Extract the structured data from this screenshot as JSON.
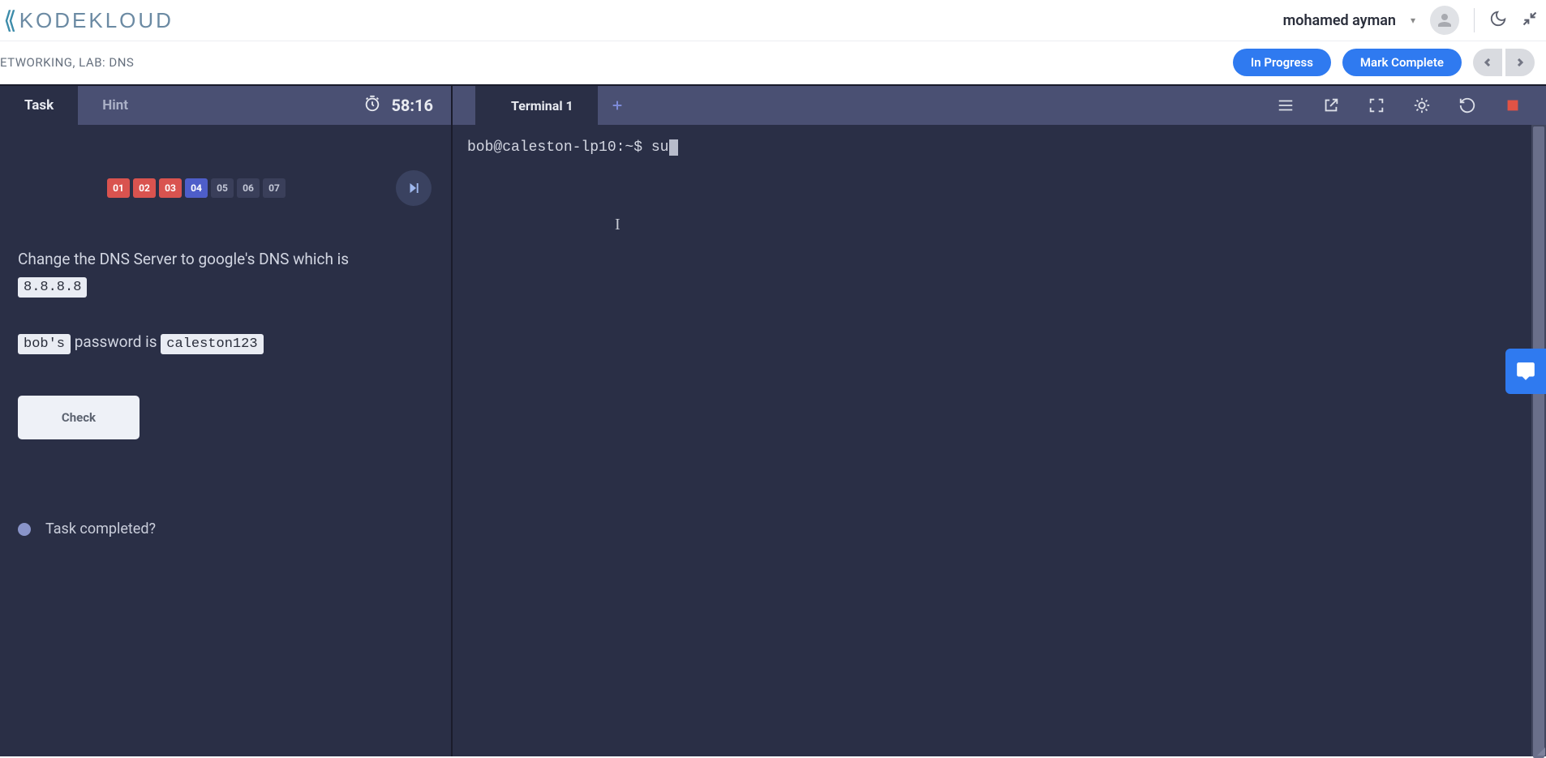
{
  "header": {
    "logo_text": "KODEKLOUD",
    "user_name": "mohamed ayman"
  },
  "subheader": {
    "breadcrumb": "ETWORKING, LAB: DNS",
    "status_label": "In Progress",
    "complete_label": "Mark Complete"
  },
  "left": {
    "tabs": {
      "task": "Task",
      "hint": "Hint"
    },
    "timer": "58:16",
    "steps": [
      "01",
      "02",
      "03",
      "04",
      "05",
      "06",
      "07"
    ],
    "task_line1": "Change the DNS Server to google's DNS which is",
    "dns_ip": "8.8.8.8",
    "task_user": "bob's",
    "pwd_label": " password is ",
    "task_pwd": "caleston123",
    "check_label": "Check",
    "completed_q": "Task completed?"
  },
  "terminal": {
    "tab_label": "Terminal 1",
    "prompt": "bob@caleston-lp10:~$ ",
    "command": "su"
  }
}
